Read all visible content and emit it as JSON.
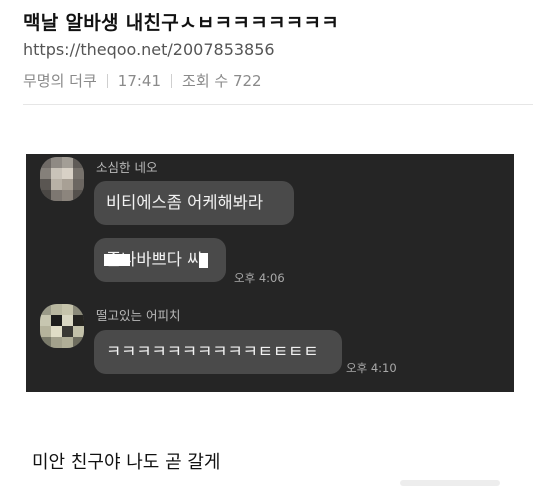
{
  "post": {
    "title": "맥날 알바생 내친구ㅅㅂㅋㅋㅋㅋㅋㅋㅋ",
    "url": "https://theqoo.net/2007853856",
    "author": "무명의 더쿠",
    "time": "17:41",
    "views_label": "조회 수 722"
  },
  "chat": {
    "messages": [
      {
        "sender": "소심한 네오",
        "bubbles": [
          {
            "text": "비티에스좀 어케해봐라"
          },
          {
            "text": "존나바쁘다 씨"
          }
        ],
        "time": "오후 4:06"
      },
      {
        "sender": "떨고있는 어피치",
        "bubbles": [
          {
            "text": "ㅋㅋㅋㅋㅋㅋㅋㅋㅋㅋㅌㅌㅌㅌ"
          }
        ],
        "time": "오후 4:10"
      }
    ]
  },
  "caption": "미안 친구야 나도 곧 갈게",
  "colors": {
    "chat_background": "#252525",
    "bubble": "#4a4a4a",
    "bubble_text": "#f2f2f2",
    "meta_text": "#8a8a8a"
  }
}
